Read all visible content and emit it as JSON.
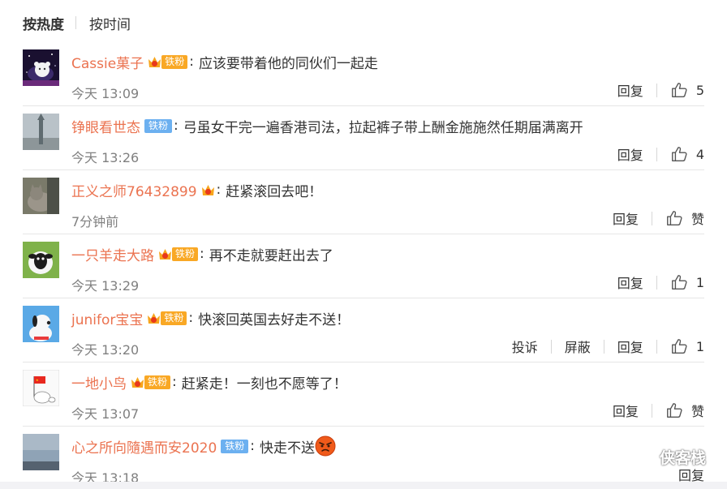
{
  "tabs": {
    "hot": "按热度",
    "time": "按时间"
  },
  "actions": {
    "reply": "回复",
    "report": "投诉",
    "block": "屏蔽"
  },
  "watermark": "侠客栈",
  "comments": [
    {
      "user": "Cassie菓子",
      "crown_level": "4",
      "fan_label": "铁粉",
      "fan_style": "orange",
      "text": "应该要带着他的同伙们一起走",
      "time": "今天 13:09",
      "likes": "5",
      "avatar": "night-sky-avatar"
    },
    {
      "user": "铮眼看世态",
      "crown_level": "",
      "fan_label": "铁粉",
      "fan_style": "blue",
      "text": "弓虽女干完一遍香港司法，拉起裤子带上酬金施施然任期届满离开",
      "time": "今天 13:26",
      "likes": "4",
      "avatar": "tower-avatar"
    },
    {
      "user": "正义之师76432899",
      "crown_level": "6",
      "fan_label": "",
      "fan_style": "",
      "text": "赶紧滚回去吧！",
      "time": "7分钟前",
      "likes": "赞",
      "avatar": "cat-avatar"
    },
    {
      "user": "一只羊走大路",
      "crown_level": "2",
      "fan_label": "铁粉",
      "fan_style": "orange",
      "text": "再不走就要赶出去了",
      "time": "今天 13:29",
      "likes": "1",
      "avatar": "sheep-avatar"
    },
    {
      "user": "junifor宝宝",
      "crown_level": "5",
      "fan_label": "铁粉",
      "fan_style": "orange",
      "text": "快滚回英国去好走不送！",
      "time": "今天 13:20",
      "likes": "1",
      "avatar": "snoopy-avatar"
    },
    {
      "user": "一地小鸟",
      "crown_level": "5",
      "fan_label": "铁粉",
      "fan_style": "orange",
      "text": "赶紧走！一刻也不愿等了！",
      "time": "今天 13:07",
      "likes": "赞",
      "avatar": "flag-avatar"
    },
    {
      "user": "心之所向隨遇而安2020",
      "crown_level": "",
      "fan_label": "铁粉",
      "fan_style": "blue",
      "text": "快走不送",
      "time": "今天 13:18",
      "likes": "",
      "avatar": "sky-avatar"
    }
  ]
}
